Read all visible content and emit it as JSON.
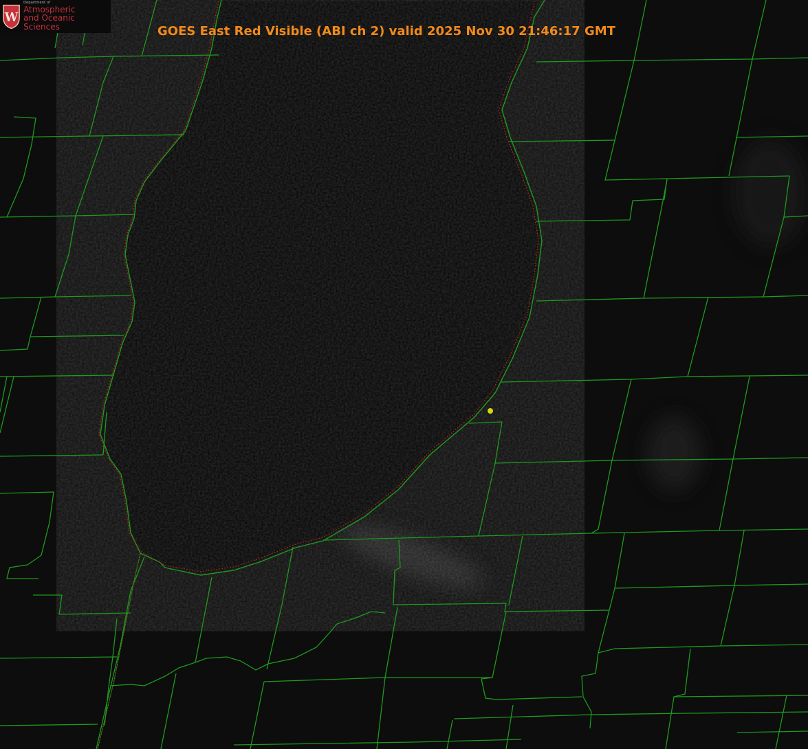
{
  "title": "GOES East Red Visible (ABI ch 2) valid 2025 Nov 30 21:46:17 GMT",
  "logo": {
    "department": "Department of",
    "line1": "Atmospheric",
    "line2": "and Oceanic Sciences",
    "crest_letter": "W"
  },
  "colors": {
    "background": "#000000",
    "land": "#0d0d0d",
    "lake": "#030303",
    "county_lines": "#1e9a1e",
    "shoreline": "#1e9a1e",
    "shoreline_dots": "#c0281e",
    "title": "#f28a1c",
    "station_marker": "#d6d60f",
    "logo_red": "#c5313c"
  },
  "map": {
    "product": "visible satellite image",
    "features": [
      "lake-michigan",
      "county-boundaries",
      "state-line",
      "station-marker"
    ]
  }
}
